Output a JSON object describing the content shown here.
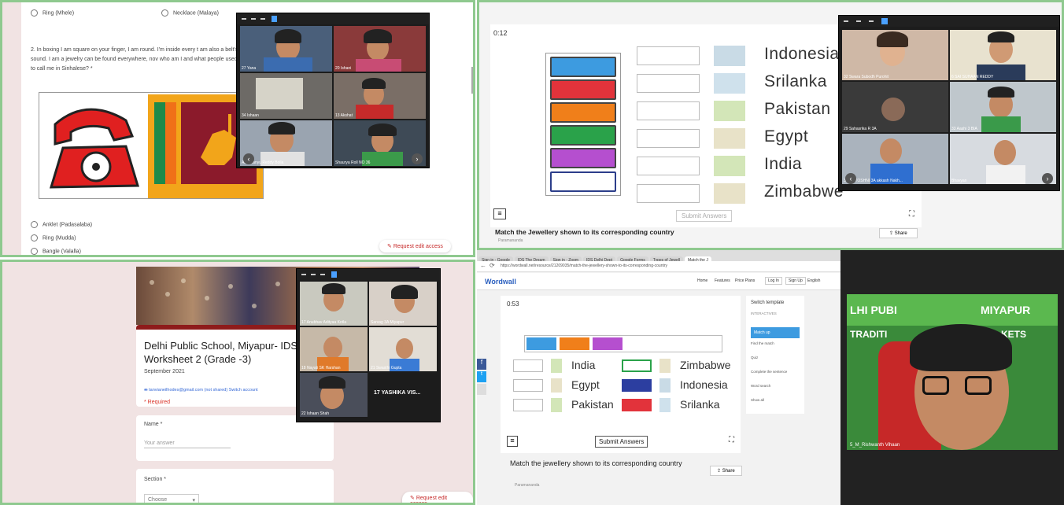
{
  "q1": {
    "top_options": [
      "Ring (Mhele)",
      "Necklace (Malaya)"
    ],
    "question": "2. In boxing I am square on your finger, I am round. I'm inside every t am also a belt's sound. I am a jewelry can be found everywhere, nov who am I and what people used to call me in Sinhalese? *",
    "options": [
      "Anklet (Padasalaba)",
      "Ring (Mudda)",
      "Bangle (Valalla)"
    ],
    "request_button": "Request edit access",
    "video_names": [
      "27 Yana",
      "20 Ishani",
      "34 Ishaan",
      "13 Akshat",
      "Abhimanyu Reddy Bolla",
      "Shaurya Roll NO 36"
    ]
  },
  "q2": {
    "timer": "0:12",
    "countries": [
      "Indonesia",
      "Srilanka",
      "Pakistan",
      "Egypt",
      "India",
      "Zimbabwe"
    ],
    "button_colors": [
      "#3d9be0",
      "#e2333b",
      "#f07f1a",
      "#2aa24a",
      "#b54fcf",
      "#ffffff"
    ],
    "submit": "Submit Answers",
    "title": "Match the Jewellery shown to its corresponding country",
    "author": "Paramananda",
    "share": "Share",
    "video_names": [
      "32 Swara Subodh Purohit",
      "6 SAI SUHAAN REDDY",
      "29 Sahasrika R 3A",
      "33 Aashi 3 BIA",
      "3 SANTOSHNI 3A akkash Nakh...",
      "Bhavyan"
    ]
  },
  "q3": {
    "title": "Delhi Public School, Miyapur- IDS Worksheet 2 (Grade -3)",
    "date": "September 2021",
    "email": "tanvianeilhodes@gmail.com (not shared) Switch account",
    "required": "* Required",
    "name_label": "Name *",
    "name_placeholder": "Your answer",
    "section_label": "Section *",
    "section_value": "Choose",
    "request_button": "Request edit access",
    "video_names": [
      "17 Anubhav Adityaa Kotla",
      "Sarvag 3A Miyapur",
      "18 Nayati SK Harshan",
      "21 Swasthi Gupta",
      "22 Ishaan Shah",
      "17 YASHIKA VIS..."
    ]
  },
  "q4": {
    "tabs": [
      "Sign in - Google",
      "IDS The Dream",
      "Sign in - Zoom",
      "IDS Delhi Dept",
      "Google Forms",
      "Types of Jewell",
      "Match the J"
    ],
    "url": "https://wordwall.net/resource/21209035/match-the-jewellery-shown-to-its-corresponding-country",
    "logo": "Wordwall",
    "nav": [
      "Home",
      "Features",
      "Price Plans",
      "Log In",
      "Sign Up",
      "English"
    ],
    "timer": "0:53",
    "left_countries": [
      "India",
      "Egypt",
      "Pakistan"
    ],
    "right_countries": [
      "Zimbabwe",
      "Indonesia",
      "Srilanka"
    ],
    "submit": "Submit Answers",
    "title": "Match the jewellery shown to its corresponding country",
    "author": "Paramananda",
    "share": "Share",
    "sidebar_title": "Switch template",
    "sidebar_section": "INTERACTIVES",
    "sidebar_items": [
      "Match up",
      "Find the match",
      "Quiz",
      "Complete the sentence",
      "Word search",
      "Show all"
    ],
    "video_banner": "MIYAPUR",
    "video_banner2": "TRADITI",
    "video_banner3": "KETS",
    "video_name": "5_M_Rishwanth Vihaan"
  }
}
